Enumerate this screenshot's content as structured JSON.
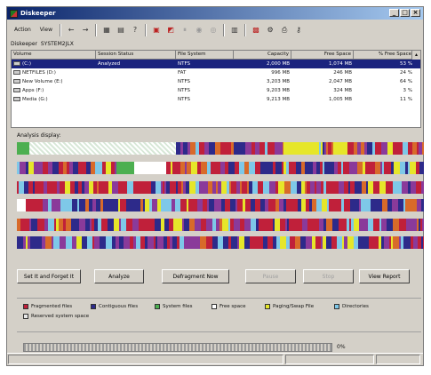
{
  "window": {
    "title": "Diskeeper"
  },
  "menu": [
    {
      "label": "Action"
    },
    {
      "label": "View"
    }
  ],
  "toolbar_icons": [
    "back-arrow-icon",
    "forward-arrow-icon",
    "tree-icon",
    "properties-icon",
    "help-icon",
    "analyze-icon",
    "defragment-icon",
    "pause-icon",
    "stop-icon",
    "report-icon",
    "schedule-icon",
    "set-it-icon",
    "options-icon",
    "print-icon",
    "key-icon"
  ],
  "path": {
    "label": "Diskeeper",
    "value": "SYSTEM2JLX"
  },
  "table": {
    "columns": [
      "Volume",
      "Session Status",
      "File System",
      "Capacity",
      "Free Space",
      "% Free Space"
    ],
    "rows": [
      {
        "volume": "(C:)",
        "status": "Analyzed",
        "fs": "NTFS",
        "capacity": "2,000 MB",
        "free": "1,074 MB",
        "pct": "53 %",
        "selected": true
      },
      {
        "volume": "NETFILES (D:)",
        "status": "",
        "fs": "FAT",
        "capacity": "996 MB",
        "free": "246 MB",
        "pct": "24 %",
        "selected": false
      },
      {
        "volume": "New Volume (E:)",
        "status": "",
        "fs": "NTFS",
        "capacity": "3,203 MB",
        "free": "2,047 MB",
        "pct": "64 %",
        "selected": false
      },
      {
        "volume": "Apps (F:)",
        "status": "",
        "fs": "NTFS",
        "capacity": "9,203 MB",
        "free": "324 MB",
        "pct": "3 %",
        "selected": false
      },
      {
        "volume": "Media (G:)",
        "status": "",
        "fs": "NTFS",
        "capacity": "9,213 MB",
        "free": "1,005 MB",
        "pct": "11 %",
        "selected": false
      }
    ]
  },
  "analysis": {
    "label": "Analysis display:"
  },
  "buttons": {
    "set_it": "Set It and Forget It",
    "analyze": "Analyze",
    "defragment": "Defragment Now",
    "pause": "Pause",
    "stop": "Stop",
    "view_report": "View Report"
  },
  "legend": [
    {
      "label": "Fragmented files",
      "color": "#c0203a"
    },
    {
      "label": "Contiguous files",
      "color": "#2d2a8a"
    },
    {
      "label": "System files",
      "color": "#4caf50"
    },
    {
      "label": "Free space",
      "color": "#ffffff"
    },
    {
      "label": "Paging/Swap File",
      "color": "#e6e62a"
    },
    {
      "label": "Directories",
      "color": "#7ec8e8"
    },
    {
      "label": "Reserved system space",
      "color": "#e8e8e8"
    }
  ],
  "progress": {
    "percent_text": "0%",
    "fraction": 0
  },
  "colors": {
    "fragmented": "#c0203a",
    "contiguous": "#2d2a8a",
    "system": "#4caf50",
    "free": "#ffffff",
    "paging": "#e6e62a",
    "directories": "#7ec8e8",
    "reserved": "#e8e8e8",
    "purple": "#8a3a9a",
    "orange": "#d86a2a"
  }
}
